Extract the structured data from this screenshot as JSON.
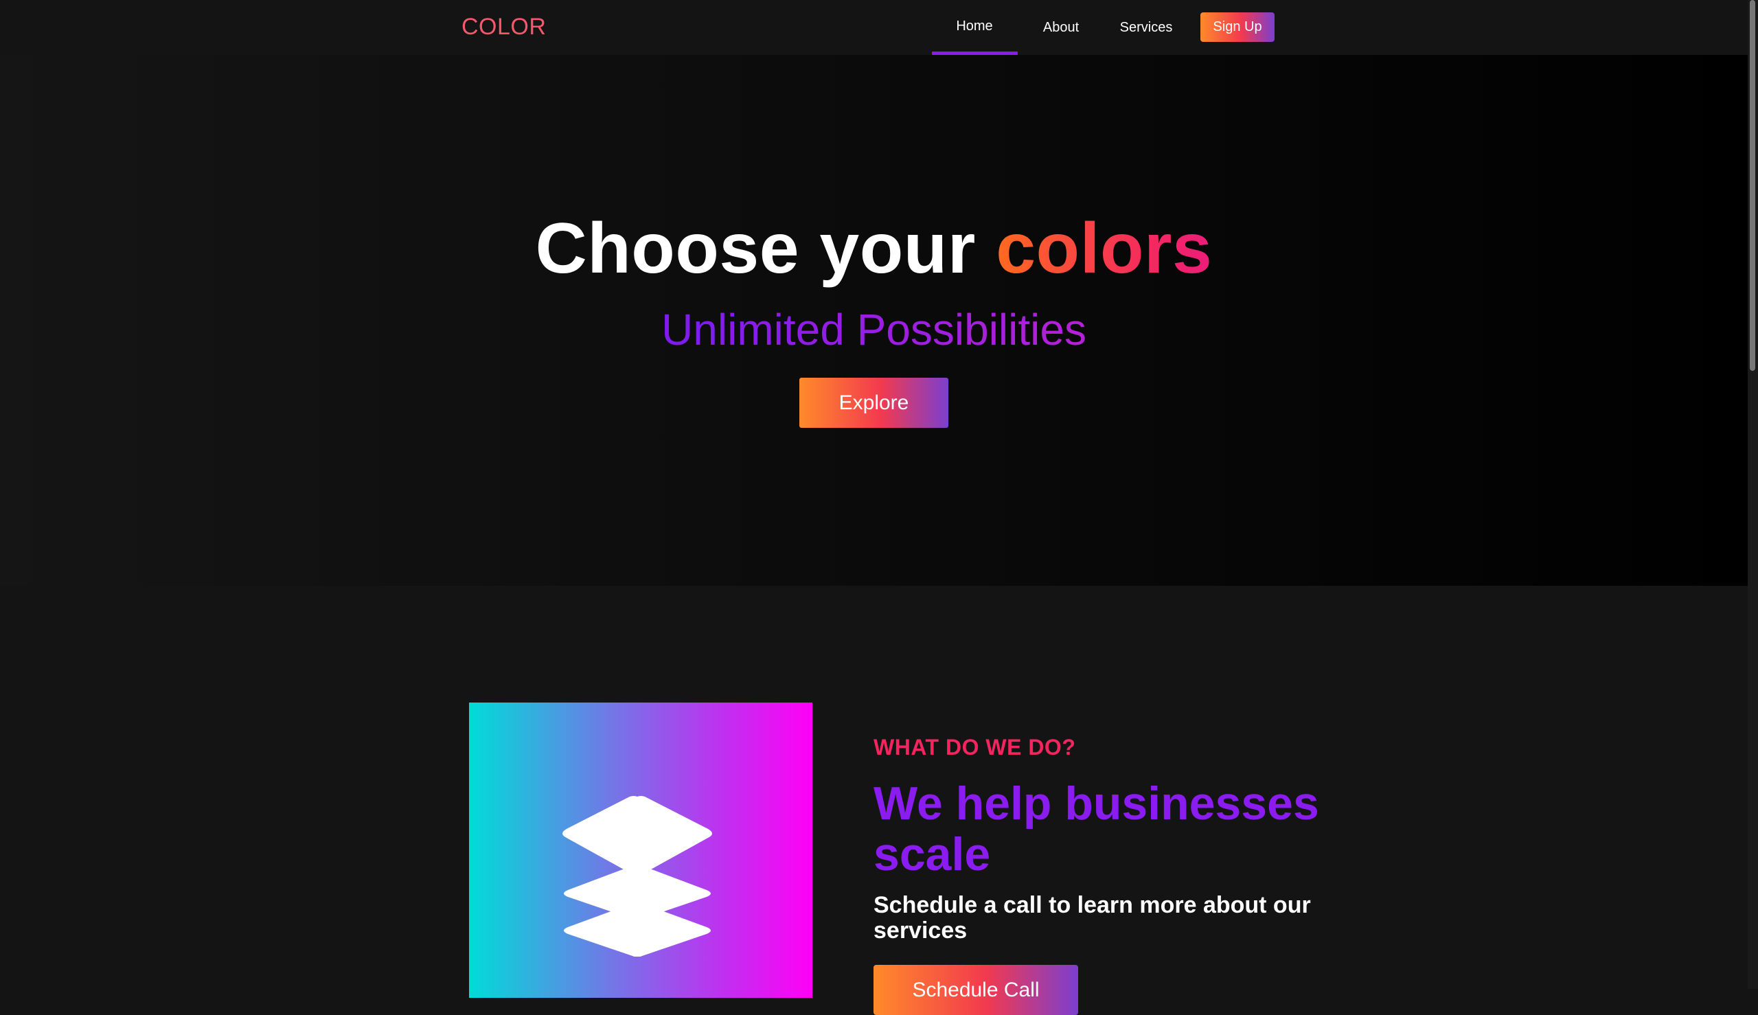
{
  "nav": {
    "logo": "COLOR",
    "home": "Home",
    "about": "About",
    "services": "Services",
    "signup": "Sign Up",
    "active_item": "Home"
  },
  "hero": {
    "title_prefix": "Choose your ",
    "title_accent": "colors",
    "subtitle": "Unlimited Possibilities",
    "cta": "Explore"
  },
  "services": {
    "eyebrow": "WHAT DO WE DO?",
    "heading": "We help businesses scale",
    "text": "Schedule a call to learn more about our services",
    "cta": "Schedule Call",
    "card_icon": "layers-icon"
  },
  "colors": {
    "brand_pink": "#f5576c",
    "accent_purple": "#8a1cf0",
    "accent_red": "#f4245f",
    "gradient_orange": "#ff8a2a",
    "gradient_cyan": "#00dcd8",
    "gradient_magenta": "#ff00f5"
  }
}
